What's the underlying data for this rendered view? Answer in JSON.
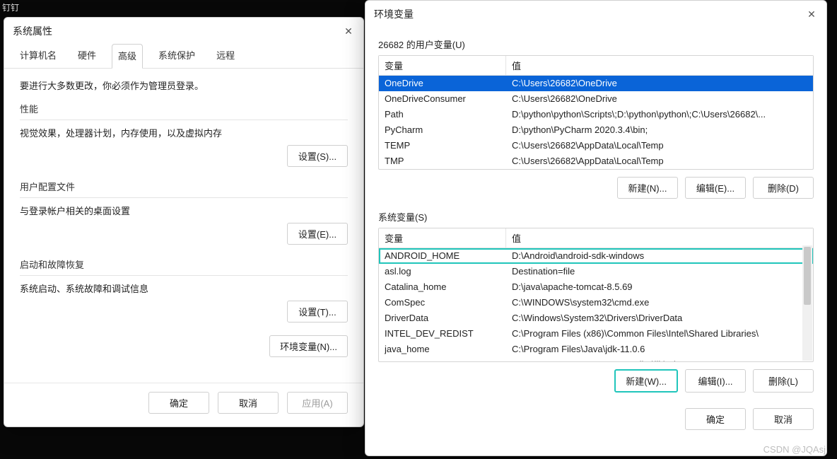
{
  "background": {
    "dingtalk": "钉钉",
    "watermark": "CSDN @JQAsj"
  },
  "system_properties": {
    "title": "系统属性",
    "tabs": [
      "计算机名",
      "硬件",
      "高级",
      "系统保护",
      "远程"
    ],
    "active_tab_index": 2,
    "admin_note": "要进行大多数更改，你必须作为管理员登录。",
    "groups": {
      "performance": {
        "label": "性能",
        "desc": "视觉效果，处理器计划，内存使用，以及虚拟内存",
        "button": "设置(S)..."
      },
      "profiles": {
        "label": "用户配置文件",
        "desc": "与登录帐户相关的桌面设置",
        "button": "设置(E)..."
      },
      "startup": {
        "label": "启动和故障恢复",
        "desc": "系统启动、系统故障和调试信息",
        "button": "设置(T)..."
      }
    },
    "env_button": "环境变量(N)...",
    "footer": {
      "ok": "确定",
      "cancel": "取消",
      "apply": "应用(A)"
    }
  },
  "env_dialog": {
    "title": "环境变量",
    "user_section_label": "26682 的用户变量(U)",
    "headers": {
      "var": "变量",
      "val": "值"
    },
    "user_vars": [
      {
        "name": "OneDrive",
        "value": "C:\\Users\\26682\\OneDrive",
        "selected": true
      },
      {
        "name": "OneDriveConsumer",
        "value": "C:\\Users\\26682\\OneDrive"
      },
      {
        "name": "Path",
        "value": "D:\\python\\python\\Scripts\\;D:\\python\\python\\;C:\\Users\\26682\\..."
      },
      {
        "name": "PyCharm",
        "value": "D:\\python\\PyCharm 2020.3.4\\bin;"
      },
      {
        "name": "TEMP",
        "value": "C:\\Users\\26682\\AppData\\Local\\Temp"
      },
      {
        "name": "TMP",
        "value": "C:\\Users\\26682\\AppData\\Local\\Temp"
      }
    ],
    "user_buttons": {
      "new": "新建(N)...",
      "edit": "编辑(E)...",
      "delete": "删除(D)"
    },
    "system_section_label": "系统变量(S)",
    "system_vars": [
      {
        "name": "ANDROID_HOME",
        "value": "D:\\Android\\android-sdk-windows",
        "outlined": true
      },
      {
        "name": "asl.log",
        "value": "Destination=file"
      },
      {
        "name": "Catalina_home",
        "value": "D:\\java\\apache-tomcat-8.5.69"
      },
      {
        "name": "ComSpec",
        "value": "C:\\WINDOWS\\system32\\cmd.exe"
      },
      {
        "name": "DriverData",
        "value": "C:\\Windows\\System32\\Drivers\\DriverData"
      },
      {
        "name": "INTEL_DEV_REDIST",
        "value": "C:\\Program Files (x86)\\Common Files\\Intel\\Shared Libraries\\"
      },
      {
        "name": "java_home",
        "value": "C:\\Program Files\\Java\\jdk-11.0.6"
      },
      {
        "name": "MIC_LD_LIBRARY_PATH",
        "value": "%INTEL_DEV_REDIST%compiler\\lib\\mic"
      }
    ],
    "system_buttons": {
      "new": "新建(W)...",
      "edit": "编辑(I)...",
      "delete": "删除(L)"
    },
    "footer": {
      "ok": "确定",
      "cancel": "取消"
    }
  }
}
